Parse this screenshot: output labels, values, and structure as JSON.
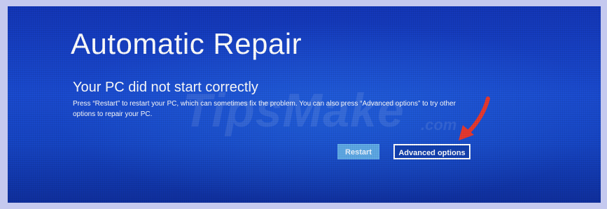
{
  "screen": {
    "title": "Automatic Repair",
    "subtitle": "Your PC did not start correctly",
    "description": "Press “Restart” to restart your PC, which can sometimes fix the problem. You can also press “Advanced options” to try other options to repair your PC."
  },
  "buttons": {
    "restart_label": "Restart",
    "advanced_label": "Advanced options"
  },
  "watermark": {
    "main": "TipsMake",
    "sub": ".com"
  },
  "colors": {
    "background": "#1a44c8",
    "restart_button": "#5ea9e6",
    "advanced_border": "#ffffff",
    "annotation_arrow": "#e8392f"
  },
  "annotation": {
    "arrow_icon": "red-arrow-icon"
  }
}
